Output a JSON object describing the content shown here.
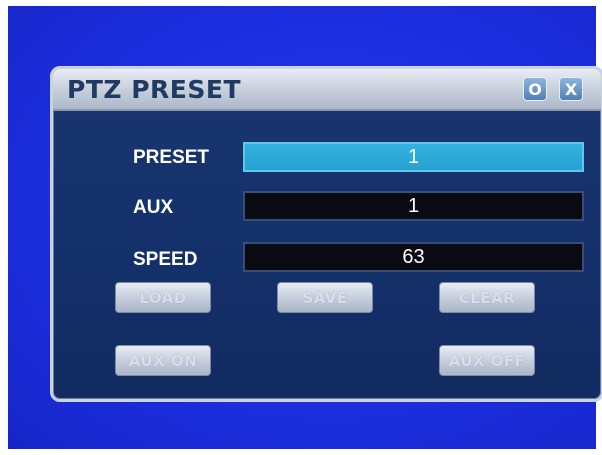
{
  "dialog": {
    "title": "PTZ PRESET",
    "title_buttons": {
      "options": "O",
      "close": "X"
    }
  },
  "fields": {
    "preset": {
      "label": "PRESET",
      "value": "1"
    },
    "aux": {
      "label": "AUX",
      "value": "1"
    },
    "speed": {
      "label": "SPEED",
      "value": "63"
    }
  },
  "buttons": {
    "load": "LOAD",
    "save": "SAVE",
    "clear": "CLEAR",
    "aux_on": "AUX ON",
    "aux_off": "AUX OFF"
  },
  "colors": {
    "screen_background": "#1c2ee0",
    "dialog_background": "#14306a",
    "selected_field": "#2ba6d6"
  }
}
